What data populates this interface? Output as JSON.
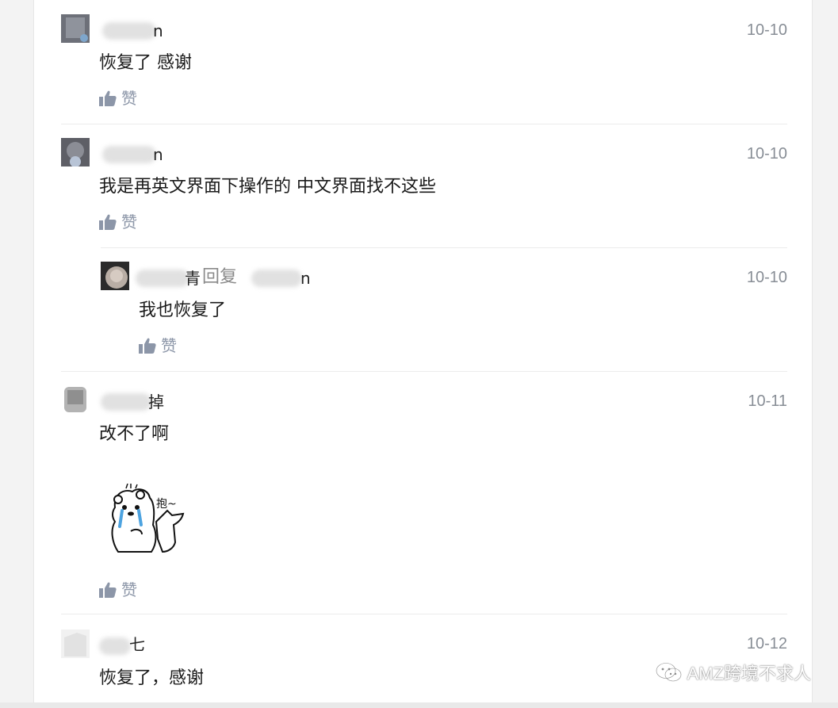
{
  "comments": [
    {
      "name_tail": "n",
      "date": "10-10",
      "text": "恢复了 感谢",
      "like_label": "赞"
    },
    {
      "name_tail": "n",
      "date": "10-10",
      "text": "我是再英文界面下操作的 中文界面找不这些",
      "like_label": "赞",
      "reply": {
        "name_tail": "青",
        "reply_word": "回复",
        "target_tail": "n",
        "date": "10-10",
        "text": "我也恢复了",
        "like_label": "赞"
      }
    },
    {
      "name_tail": "掉",
      "date": "10-11",
      "text": "改不了啊",
      "sticker_text": "抱~",
      "like_label": "赞"
    },
    {
      "name_tail": "七",
      "date": "10-12",
      "text": "恢复了，感谢"
    }
  ],
  "watermark": {
    "text": "AMZ跨境不求人",
    "icon": "wechat-icon"
  },
  "colors": {
    "like": "#8c96a8",
    "date": "#888e96",
    "text": "#1a1a1a"
  }
}
